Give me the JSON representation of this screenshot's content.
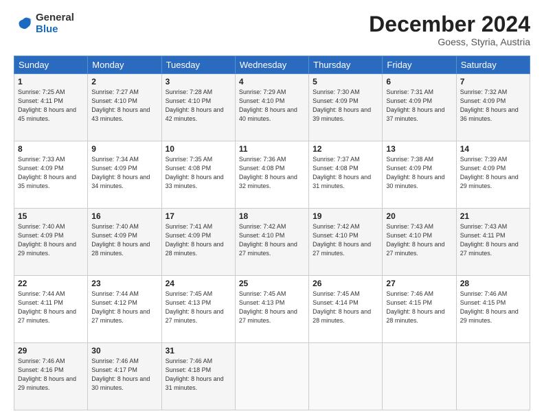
{
  "logo": {
    "general": "General",
    "blue": "Blue"
  },
  "header": {
    "month": "December 2024",
    "location": "Goess, Styria, Austria"
  },
  "days_of_week": [
    "Sunday",
    "Monday",
    "Tuesday",
    "Wednesday",
    "Thursday",
    "Friday",
    "Saturday"
  ],
  "weeks": [
    [
      {
        "day": 1,
        "sunrise": "7:25 AM",
        "sunset": "4:11 PM",
        "daylight": "8 hours and 45 minutes."
      },
      {
        "day": 2,
        "sunrise": "7:27 AM",
        "sunset": "4:10 PM",
        "daylight": "8 hours and 43 minutes."
      },
      {
        "day": 3,
        "sunrise": "7:28 AM",
        "sunset": "4:10 PM",
        "daylight": "8 hours and 42 minutes."
      },
      {
        "day": 4,
        "sunrise": "7:29 AM",
        "sunset": "4:10 PM",
        "daylight": "8 hours and 40 minutes."
      },
      {
        "day": 5,
        "sunrise": "7:30 AM",
        "sunset": "4:09 PM",
        "daylight": "8 hours and 39 minutes."
      },
      {
        "day": 6,
        "sunrise": "7:31 AM",
        "sunset": "4:09 PM",
        "daylight": "8 hours and 37 minutes."
      },
      {
        "day": 7,
        "sunrise": "7:32 AM",
        "sunset": "4:09 PM",
        "daylight": "8 hours and 36 minutes."
      }
    ],
    [
      {
        "day": 8,
        "sunrise": "7:33 AM",
        "sunset": "4:09 PM",
        "daylight": "8 hours and 35 minutes."
      },
      {
        "day": 9,
        "sunrise": "7:34 AM",
        "sunset": "4:09 PM",
        "daylight": "8 hours and 34 minutes."
      },
      {
        "day": 10,
        "sunrise": "7:35 AM",
        "sunset": "4:08 PM",
        "daylight": "8 hours and 33 minutes."
      },
      {
        "day": 11,
        "sunrise": "7:36 AM",
        "sunset": "4:08 PM",
        "daylight": "8 hours and 32 minutes."
      },
      {
        "day": 12,
        "sunrise": "7:37 AM",
        "sunset": "4:08 PM",
        "daylight": "8 hours and 31 minutes."
      },
      {
        "day": 13,
        "sunrise": "7:38 AM",
        "sunset": "4:09 PM",
        "daylight": "8 hours and 30 minutes."
      },
      {
        "day": 14,
        "sunrise": "7:39 AM",
        "sunset": "4:09 PM",
        "daylight": "8 hours and 29 minutes."
      }
    ],
    [
      {
        "day": 15,
        "sunrise": "7:40 AM",
        "sunset": "4:09 PM",
        "daylight": "8 hours and 29 minutes."
      },
      {
        "day": 16,
        "sunrise": "7:40 AM",
        "sunset": "4:09 PM",
        "daylight": "8 hours and 28 minutes."
      },
      {
        "day": 17,
        "sunrise": "7:41 AM",
        "sunset": "4:09 PM",
        "daylight": "8 hours and 28 minutes."
      },
      {
        "day": 18,
        "sunrise": "7:42 AM",
        "sunset": "4:10 PM",
        "daylight": "8 hours and 27 minutes."
      },
      {
        "day": 19,
        "sunrise": "7:42 AM",
        "sunset": "4:10 PM",
        "daylight": "8 hours and 27 minutes."
      },
      {
        "day": 20,
        "sunrise": "7:43 AM",
        "sunset": "4:10 PM",
        "daylight": "8 hours and 27 minutes."
      },
      {
        "day": 21,
        "sunrise": "7:43 AM",
        "sunset": "4:11 PM",
        "daylight": "8 hours and 27 minutes."
      }
    ],
    [
      {
        "day": 22,
        "sunrise": "7:44 AM",
        "sunset": "4:11 PM",
        "daylight": "8 hours and 27 minutes."
      },
      {
        "day": 23,
        "sunrise": "7:44 AM",
        "sunset": "4:12 PM",
        "daylight": "8 hours and 27 minutes."
      },
      {
        "day": 24,
        "sunrise": "7:45 AM",
        "sunset": "4:13 PM",
        "daylight": "8 hours and 27 minutes."
      },
      {
        "day": 25,
        "sunrise": "7:45 AM",
        "sunset": "4:13 PM",
        "daylight": "8 hours and 27 minutes."
      },
      {
        "day": 26,
        "sunrise": "7:45 AM",
        "sunset": "4:14 PM",
        "daylight": "8 hours and 28 minutes."
      },
      {
        "day": 27,
        "sunrise": "7:46 AM",
        "sunset": "4:15 PM",
        "daylight": "8 hours and 28 minutes."
      },
      {
        "day": 28,
        "sunrise": "7:46 AM",
        "sunset": "4:15 PM",
        "daylight": "8 hours and 29 minutes."
      }
    ],
    [
      {
        "day": 29,
        "sunrise": "7:46 AM",
        "sunset": "4:16 PM",
        "daylight": "8 hours and 29 minutes."
      },
      {
        "day": 30,
        "sunrise": "7:46 AM",
        "sunset": "4:17 PM",
        "daylight": "8 hours and 30 minutes."
      },
      {
        "day": 31,
        "sunrise": "7:46 AM",
        "sunset": "4:18 PM",
        "daylight": "8 hours and 31 minutes."
      },
      null,
      null,
      null,
      null
    ]
  ]
}
